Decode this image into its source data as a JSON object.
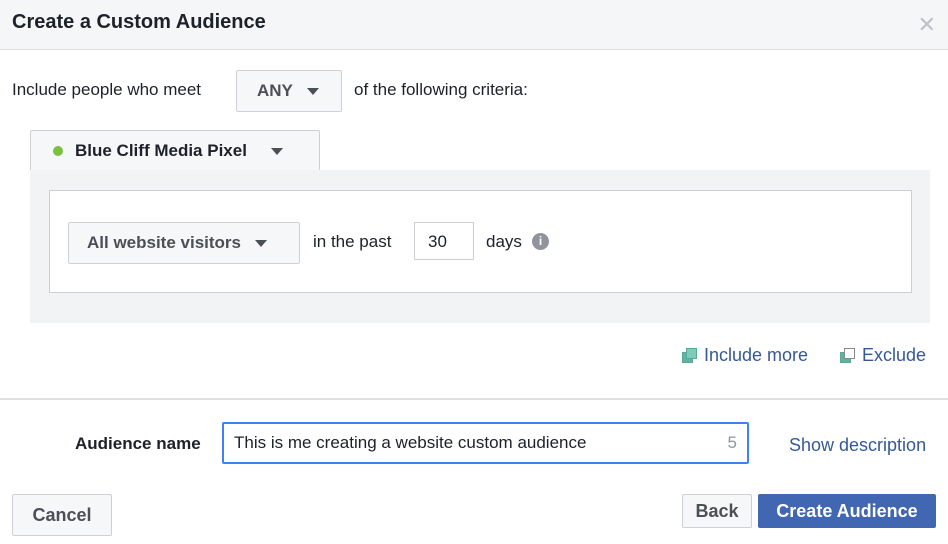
{
  "dialog": {
    "title": "Create a Custom Audience",
    "close_icon": "close-icon"
  },
  "criteria": {
    "prefix": "Include people who meet",
    "match": "ANY",
    "suffix": "of the following criteria:"
  },
  "pixel": {
    "name": "Blue Cliff Media Pixel",
    "status_color": "#7ac142"
  },
  "rule": {
    "event": "All website visitors",
    "in_past": "in the past",
    "days_value": "30",
    "days_label": "days"
  },
  "actions": {
    "include_more": "Include more",
    "exclude": "Exclude"
  },
  "audience_name": {
    "label": "Audience name",
    "value": "This is me creating a website custom audience",
    "char_count": "5",
    "show_description": "Show description"
  },
  "footer": {
    "cancel": "Cancel",
    "back": "Back",
    "create": "Create Audience",
    "primary_color": "#4267b2"
  }
}
